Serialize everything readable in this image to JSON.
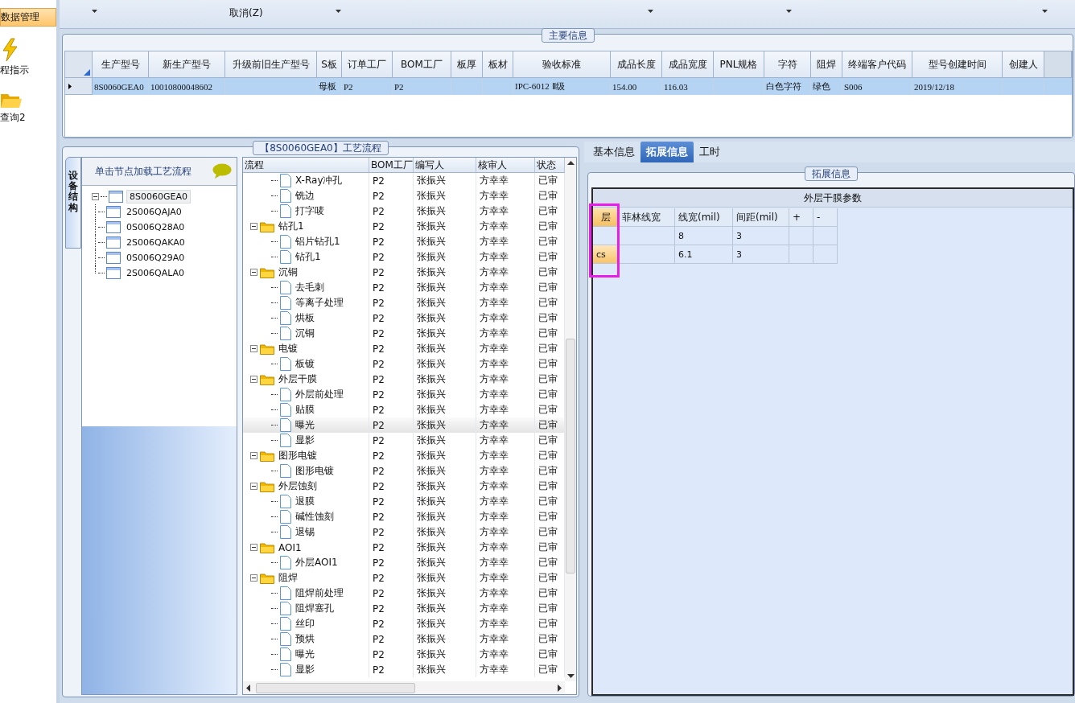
{
  "nav": {
    "items": [
      {
        "label": "数据管理",
        "selected": true
      },
      {
        "label": "程指示",
        "selected": false
      },
      {
        "label": "查询2",
        "selected": false
      }
    ]
  },
  "toolbar": {
    "cancel_label": "取消(Z)"
  },
  "main_info": {
    "title": "主要信息",
    "columns": [
      "生产型号",
      "新生产型号",
      "升级前旧生产型号",
      "S板",
      "订单工厂",
      "BOM工厂",
      "板厚",
      "板材",
      "验收标准",
      "成品长度",
      "成品宽度",
      "PNL规格",
      "字符",
      "阻焊",
      "终端客户代码",
      "型号创建时间",
      "创建人"
    ],
    "rows": [
      {
        "selected": true,
        "cells": [
          "8S0060GEA0",
          "10010800048602",
          null,
          "母板",
          "P2",
          "P2",
          null,
          null,
          "IPC-6012 Ⅱ级",
          "154.00",
          "116.03",
          null,
          "白色字符",
          "绿色",
          "S006",
          "2019/12/18",
          null
        ]
      }
    ]
  },
  "process_panel": {
    "title": "【8S0060GEA0】工艺流程",
    "structure": {
      "tab_label": "设备结构",
      "hint": "单击节点加载工艺流程",
      "root": {
        "label": "8S0060GEA0",
        "selected": true,
        "expanded": true,
        "children": [
          {
            "label": "2S006QAJA0",
            "selected": false
          },
          {
            "label": "0S006Q28A0",
            "selected": false
          },
          {
            "label": "2S006QAKA0",
            "selected": false
          },
          {
            "label": "0S006Q29A0",
            "selected": false
          },
          {
            "label": "2S006QALA0",
            "selected": false
          }
        ]
      }
    },
    "columns": [
      "流程",
      "BOM工厂",
      "编写人",
      "核审人",
      "状态"
    ],
    "rows": [
      {
        "children": [
          {
            "label": "X-Ray冲孔",
            "bom": "P2",
            "author": "张振兴",
            "reviewer": "方幸幸",
            "status": "已审",
            "selected": false
          },
          {
            "label": "铣边",
            "bom": "P2",
            "author": "张振兴",
            "reviewer": "方幸幸",
            "status": "已审",
            "selected": false
          },
          {
            "label": "打字唛",
            "bom": "P2",
            "author": "张振兴",
            "reviewer": "方幸幸",
            "status": "已审",
            "selected": false
          }
        ]
      },
      {
        "label": "钻孔1",
        "bom": "P2",
        "author": "张振兴",
        "reviewer": "方幸幸",
        "status": "已审",
        "selected": false,
        "expanded": true,
        "children": [
          {
            "label": "铝片钻孔1",
            "bom": "P2",
            "author": "张振兴",
            "reviewer": "方幸幸",
            "status": "已审",
            "selected": false
          },
          {
            "label": "钻孔1",
            "bom": "P2",
            "author": "张振兴",
            "reviewer": "方幸幸",
            "status": "已审",
            "selected": false
          }
        ]
      },
      {
        "label": "沉铜",
        "bom": "P2",
        "author": "张振兴",
        "reviewer": "方幸幸",
        "status": "已审",
        "selected": false,
        "expanded": true,
        "children": [
          {
            "label": "去毛刺",
            "bom": "P2",
            "author": "张振兴",
            "reviewer": "方幸幸",
            "status": "已审",
            "selected": false
          },
          {
            "label": "等离子处理",
            "bom": "P2",
            "author": "张振兴",
            "reviewer": "方幸幸",
            "status": "已审",
            "selected": false
          },
          {
            "label": "烘板",
            "bom": "P2",
            "author": "张振兴",
            "reviewer": "方幸幸",
            "status": "已审",
            "selected": false
          },
          {
            "label": "沉铜",
            "bom": "P2",
            "author": "张振兴",
            "reviewer": "方幸幸",
            "status": "已审",
            "selected": false
          }
        ]
      },
      {
        "label": "电镀",
        "bom": "P2",
        "author": "张振兴",
        "reviewer": "方幸幸",
        "status": "已审",
        "selected": false,
        "expanded": true,
        "children": [
          {
            "label": "板镀",
            "bom": "P2",
            "author": "张振兴",
            "reviewer": "方幸幸",
            "status": "已审",
            "selected": false
          }
        ]
      },
      {
        "label": "外层干膜",
        "bom": "P2",
        "author": "张振兴",
        "reviewer": "方幸幸",
        "status": "已审",
        "selected": false,
        "expanded": true,
        "children": [
          {
            "label": "外层前处理",
            "bom": "P2",
            "author": "张振兴",
            "reviewer": "方幸幸",
            "status": "已审",
            "selected": false
          },
          {
            "label": "贴膜",
            "bom": "P2",
            "author": "张振兴",
            "reviewer": "方幸幸",
            "status": "已审",
            "selected": false
          },
          {
            "label": "曝光",
            "bom": "P2",
            "author": "张振兴",
            "reviewer": "方幸幸",
            "status": "已审",
            "selected": true
          },
          {
            "label": "显影",
            "bom": "P2",
            "author": "张振兴",
            "reviewer": "方幸幸",
            "status": "已审",
            "selected": false
          }
        ]
      },
      {
        "label": "图形电镀",
        "bom": "P2",
        "author": "张振兴",
        "reviewer": "方幸幸",
        "status": "已审",
        "selected": false,
        "expanded": true,
        "children": [
          {
            "label": "图形电镀",
            "bom": "P2",
            "author": "张振兴",
            "reviewer": "方幸幸",
            "status": "已审",
            "selected": false
          }
        ]
      },
      {
        "label": "外层蚀刻",
        "bom": "P2",
        "author": "张振兴",
        "reviewer": "方幸幸",
        "status": "已审",
        "selected": false,
        "expanded": true,
        "children": [
          {
            "label": "退膜",
            "bom": "P2",
            "author": "张振兴",
            "reviewer": "方幸幸",
            "status": "已审",
            "selected": false
          },
          {
            "label": "碱性蚀刻",
            "bom": "P2",
            "author": "张振兴",
            "reviewer": "方幸幸",
            "status": "已审",
            "selected": false
          },
          {
            "label": "退锡",
            "bom": "P2",
            "author": "张振兴",
            "reviewer": "方幸幸",
            "status": "已审",
            "selected": false
          }
        ]
      },
      {
        "label": "AOI1",
        "bom": "P2",
        "author": "张振兴",
        "reviewer": "方幸幸",
        "status": "已审",
        "selected": false,
        "expanded": true,
        "children": [
          {
            "label": "外层AOI1",
            "bom": "P2",
            "author": "张振兴",
            "reviewer": "方幸幸",
            "status": "已审",
            "selected": false
          }
        ]
      },
      {
        "label": "阻焊",
        "bom": "P2",
        "author": "张振兴",
        "reviewer": "方幸幸",
        "status": "已审",
        "selected": false,
        "expanded": true,
        "children": [
          {
            "label": "阻焊前处理",
            "bom": "P2",
            "author": "张振兴",
            "reviewer": "方幸幸",
            "status": "已审",
            "selected": false
          },
          {
            "label": "阻焊塞孔",
            "bom": "P2",
            "author": "张振兴",
            "reviewer": "方幸幸",
            "status": "已审",
            "selected": false
          },
          {
            "label": "丝印",
            "bom": "P2",
            "author": "张振兴",
            "reviewer": "方幸幸",
            "status": "已审",
            "selected": false
          },
          {
            "label": "预烘",
            "bom": "P2",
            "author": "张振兴",
            "reviewer": "方幸幸",
            "status": "已审",
            "selected": false
          },
          {
            "label": "曝光",
            "bom": "P2",
            "author": "张振兴",
            "reviewer": "方幸幸",
            "status": "已审",
            "selected": false
          },
          {
            "label": "显影",
            "bom": "P2",
            "author": "张振兴",
            "reviewer": "方幸幸",
            "status": "已审",
            "selected": false
          }
        ]
      }
    ]
  },
  "detail": {
    "tabs": [
      {
        "label": "基本信息",
        "selected": false
      },
      {
        "label": "拓展信息",
        "selected": true
      },
      {
        "label": "工时",
        "selected": false
      }
    ],
    "group_title": "拓展信息",
    "table": {
      "title": "外层干膜参数",
      "columns": [
        "层",
        "菲林线宽",
        "线宽(mil)",
        "间距(mil)",
        "+",
        "-"
      ],
      "rows": [
        {
          "selected": false,
          "cells": [
            null,
            null,
            "8",
            "3",
            null,
            null
          ]
        },
        {
          "selected": true,
          "cells": [
            "cs",
            null,
            "6.1",
            "3",
            null,
            null
          ]
        }
      ]
    }
  }
}
